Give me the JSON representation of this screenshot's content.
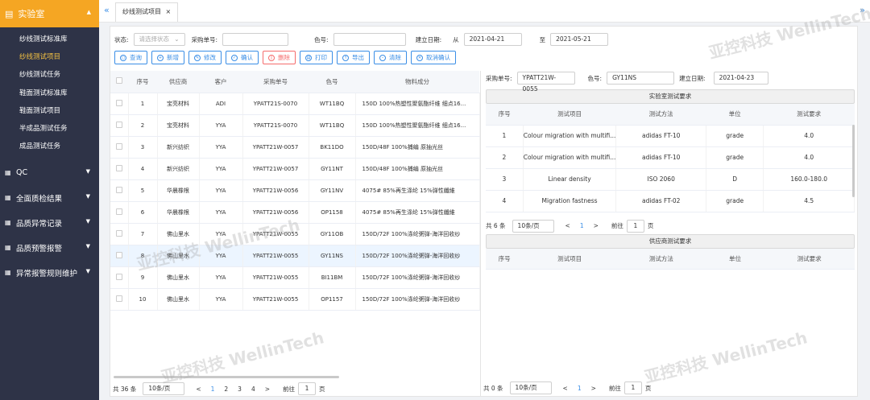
{
  "sidebar": {
    "head_label": "实验室",
    "sub_items": [
      "纱线测试标准库",
      "纱线测试项目",
      "纱线测试任务",
      "鞋面测试标准库",
      "鞋面测试项目",
      "半成品测试任务",
      "成品测试任务"
    ],
    "groups": [
      "QC",
      "全面质检结果",
      "品质异常记录",
      "品质预警报警",
      "异常报警规则维护"
    ]
  },
  "tab": {
    "label": "纱线测试项目",
    "close": "×"
  },
  "filters": {
    "status_label": "状态:",
    "status_placeholder": "请选择状态",
    "po_label": "采购单号:",
    "po_value": "",
    "color_label": "色号:",
    "color_value": "",
    "date_label": "建立日期:",
    "from_label": "从",
    "from_value": "2021-04-21",
    "to_label": "至",
    "to_value": "2021-05-21"
  },
  "buttons": [
    "查询",
    "新增",
    "修改",
    "确认",
    "删除",
    "打印",
    "导出",
    "清除",
    "取消确认"
  ],
  "left_table": {
    "headers": [
      "序号",
      "供应商",
      "客户",
      "采购单号",
      "色号",
      "物料成分"
    ],
    "rows": [
      [
        "1",
        "宝亮材料",
        "ADI",
        "YPATT21S-0070",
        "WT11BQ",
        "150D 100%热塑性聚氨酯纤维 细点16..."
      ],
      [
        "2",
        "宝亮材料",
        "YYA",
        "YPATT21S-0070",
        "WT11BQ",
        "150D 100%热塑性聚氨酯纤维 细点16..."
      ],
      [
        "3",
        "新兴纺织",
        "YYA",
        "YPATT21W-0057",
        "BK11DO",
        "150D/48F 100%捕编 原抽光丝"
      ],
      [
        "4",
        "新兴纺织",
        "YYA",
        "YPATT21W-0057",
        "GY11NT",
        "150D/48F 100%捕编 原抽光丝"
      ],
      [
        "5",
        "华晨橡根",
        "YYA",
        "YPATT21W-0056",
        "GY11NV",
        "4075# 85%再生涤纶 15%弹性纖維"
      ],
      [
        "6",
        "华晨橡根",
        "YYA",
        "YPATT21W-0056",
        "OP1158",
        "4075# 85%再生涤纶 15%弹性纖維"
      ],
      [
        "7",
        "佛山里水",
        "YYA",
        "YPATT21W-0055",
        "GY11OB",
        "150D/72F 100%涤纶粥弹-海洋回收纱"
      ],
      [
        "8",
        "佛山里水",
        "YYA",
        "YPATT21W-0055",
        "GY11NS",
        "150D/72F 100%涤纶粥弹-海洋回收纱"
      ],
      [
        "9",
        "佛山里水",
        "YYA",
        "YPATT21W-0055",
        "BI11BM",
        "150D/72F 100%涤纶粥弹-海洋回收纱"
      ],
      [
        "10",
        "佛山里水",
        "YYA",
        "YPATT21W-0055",
        "OP1157",
        "150D/72F 100%涤纶粥弹-海洋回收纱"
      ]
    ],
    "selected_index": 7,
    "pager": {
      "total": "共 36 条",
      "page_size": "10条/页",
      "pages": [
        "1",
        "2",
        "3",
        "4"
      ],
      "current": "1",
      "prev": "<",
      "next": ">",
      "goto_label": "前往",
      "goto_value": "1",
      "page_suffix": "页"
    }
  },
  "right_panel": {
    "po_label": "采购单号:",
    "po_value": "YPATT21W-0055",
    "color_label": "色号:",
    "color_value": "GY11NS",
    "date_label": "建立日期:",
    "date_value": "2021-04-23",
    "lab_title": "实验室测试要求",
    "lab_headers": [
      "序号",
      "测试项目",
      "测试方法",
      "单位",
      "测试要求"
    ],
    "lab_rows": [
      [
        "1",
        "Colour migration with multifi...",
        "adidas FT-10",
        "grade",
        "4.0"
      ],
      [
        "2",
        "Colour migration with multifi...",
        "adidas FT-10",
        "grade",
        "4.0"
      ],
      [
        "3",
        "Linear density",
        "ISO 2060",
        "D",
        "160.0-180.0"
      ],
      [
        "4",
        "Migration fastness",
        "adidas FT-02",
        "grade",
        "4.5"
      ]
    ],
    "lab_pager": {
      "total": "共 6 条",
      "page_size": "10条/页",
      "current": "1",
      "prev": "<",
      "next": ">",
      "goto_label": "前往",
      "goto_value": "1",
      "page_suffix": "页"
    },
    "supplier_title": "供应商测试要求",
    "supplier_headers": [
      "序号",
      "测试项目",
      "测试方法",
      "单位",
      "测试要求"
    ],
    "supplier_pager": {
      "total": "共 0 条",
      "page_size": "10条/页",
      "current": "1",
      "prev": "<",
      "next": ">",
      "goto_label": "前往",
      "goto_value": "1",
      "page_suffix": "页"
    }
  },
  "watermarks": [
    "亚控科技 WellinTech",
    "亚控科技 WellinTech",
    "亚控科技 WellinTech",
    "亚控科技 WellinTech"
  ],
  "colors": {
    "accent": "#f5a623",
    "sidebar": "#2e3347",
    "primary": "#3a8ee6",
    "danger": "#f56c6c"
  }
}
